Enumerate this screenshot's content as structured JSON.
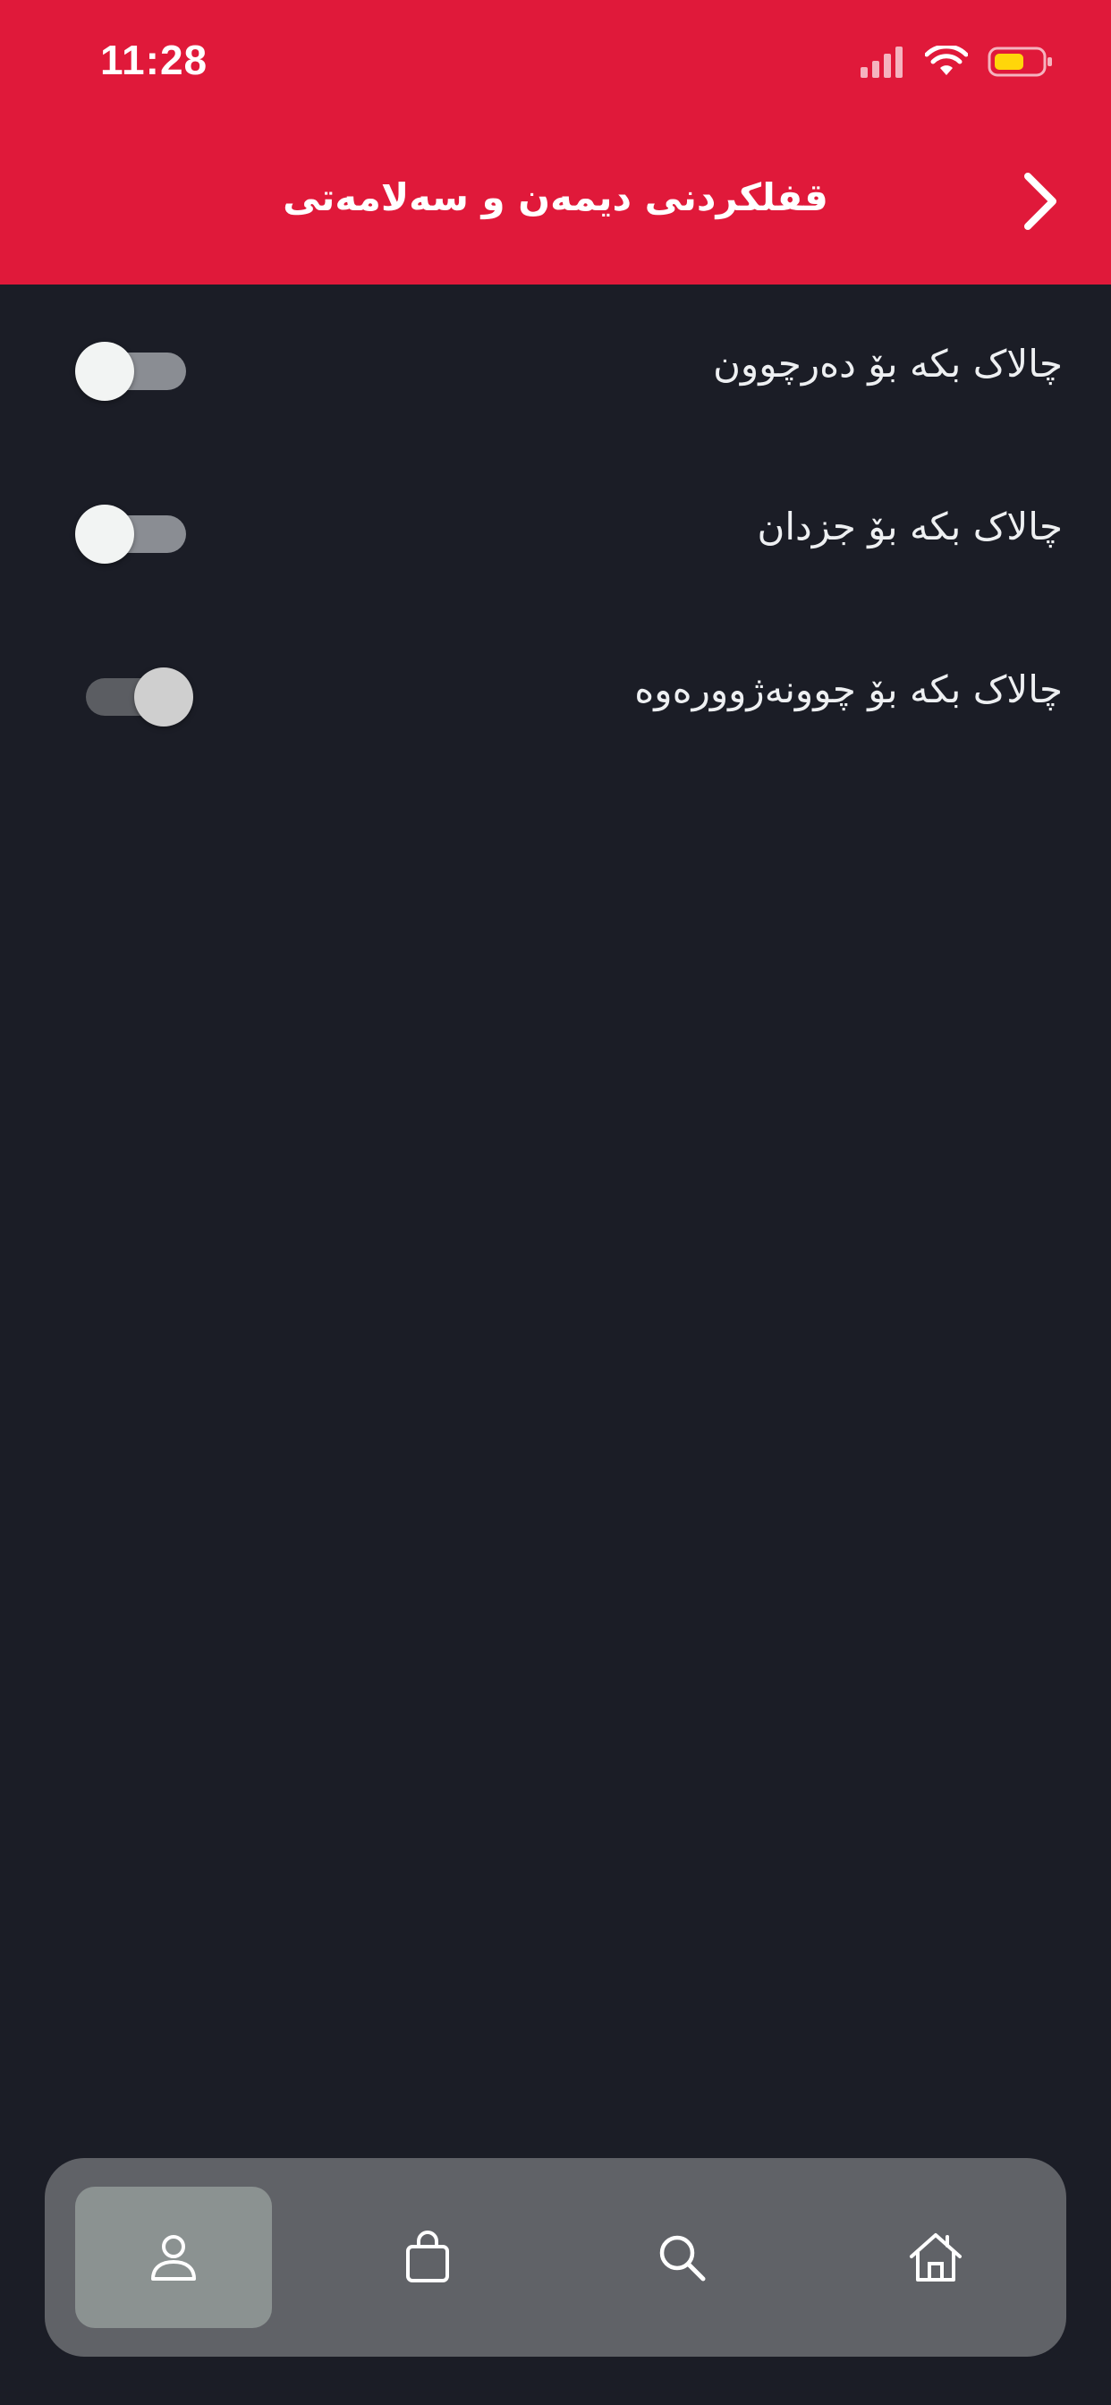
{
  "status_bar": {
    "time": "11:28"
  },
  "header": {
    "title": "قفلکردنی دیمەن و سەلامەتی",
    "back_icon": "chevron-right-icon"
  },
  "settings": [
    {
      "label": "چالاک بکە بۆ دەرچوون",
      "enabled": false
    },
    {
      "label": "چالاک بکە بۆ جزدان",
      "enabled": false
    },
    {
      "label": "چالاک بکە بۆ چوونەژوورەوە",
      "enabled": true
    }
  ],
  "tab_bar": {
    "tabs": [
      {
        "icon": "person-icon",
        "active": true
      },
      {
        "icon": "shopping-bag-icon",
        "active": false
      },
      {
        "icon": "search-icon",
        "active": false
      },
      {
        "icon": "home-icon",
        "active": false
      }
    ]
  },
  "colors": {
    "header_bg": "#e0193a",
    "page_bg": "#1b1d26",
    "tabbar_bg": "#606267",
    "active_tab_bg": "#8b9291",
    "battery_fill": "#ffd60a"
  }
}
